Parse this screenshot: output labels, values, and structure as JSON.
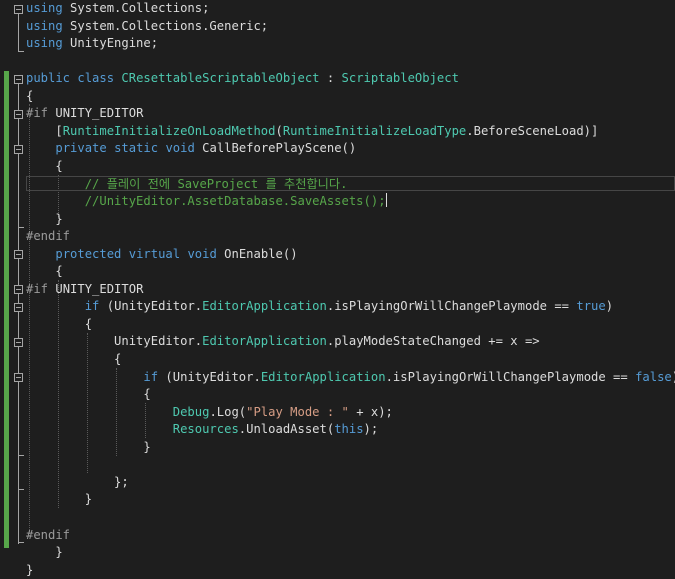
{
  "editor": {
    "lines": [
      [
        {
          "t": "using",
          "c": "kw"
        },
        {
          "t": " System.Collections;",
          "c": "tx"
        }
      ],
      [
        {
          "t": "using",
          "c": "kw"
        },
        {
          "t": " System.Collections.Generic;",
          "c": "tx"
        }
      ],
      [
        {
          "t": "using",
          "c": "kw"
        },
        {
          "t": " UnityEngine;",
          "c": "tx"
        }
      ],
      [],
      [
        {
          "t": "public",
          "c": "kw"
        },
        {
          "t": " ",
          "c": "tx"
        },
        {
          "t": "class",
          "c": "kw"
        },
        {
          "t": " ",
          "c": "tx"
        },
        {
          "t": "CResettableScriptableObject",
          "c": "ty"
        },
        {
          "t": " : ",
          "c": "tx"
        },
        {
          "t": "ScriptableObject",
          "c": "ty"
        }
      ],
      [
        {
          "t": "{",
          "c": "tx"
        }
      ],
      [
        {
          "t": "#if",
          "c": "pp"
        },
        {
          "t": " UNITY_EDITOR",
          "c": "tx"
        }
      ],
      [
        {
          "t": "    [",
          "c": "tx"
        },
        {
          "t": "RuntimeInitializeOnLoadMethod",
          "c": "ty"
        },
        {
          "t": "(",
          "c": "tx"
        },
        {
          "t": "RuntimeInitializeLoadType",
          "c": "ty"
        },
        {
          "t": ".BeforeSceneLoad)]",
          "c": "tx"
        }
      ],
      [
        {
          "t": "    ",
          "c": "tx"
        },
        {
          "t": "private",
          "c": "kw"
        },
        {
          "t": " ",
          "c": "tx"
        },
        {
          "t": "static",
          "c": "kw"
        },
        {
          "t": " ",
          "c": "tx"
        },
        {
          "t": "void",
          "c": "kw"
        },
        {
          "t": " CallBeforePlayScene()",
          "c": "tx"
        }
      ],
      [
        {
          "t": "    {",
          "c": "tx"
        }
      ],
      [
        {
          "t": "        // 플레이 전에 SaveProject 를 추천합니다.",
          "c": "cm"
        }
      ],
      [
        {
          "t": "        //UnityEditor.AssetDatabase.SaveAssets();",
          "c": "cm"
        }
      ],
      [
        {
          "t": "    }",
          "c": "tx"
        }
      ],
      [
        {
          "t": "#endif",
          "c": "pp"
        }
      ],
      [
        {
          "t": "    ",
          "c": "tx"
        },
        {
          "t": "protected",
          "c": "kw"
        },
        {
          "t": " ",
          "c": "tx"
        },
        {
          "t": "virtual",
          "c": "kw"
        },
        {
          "t": " ",
          "c": "tx"
        },
        {
          "t": "void",
          "c": "kw"
        },
        {
          "t": " OnEnable()",
          "c": "tx"
        }
      ],
      [
        {
          "t": "    {",
          "c": "tx"
        }
      ],
      [
        {
          "t": "#if",
          "c": "pp"
        },
        {
          "t": " UNITY_EDITOR",
          "c": "tx"
        }
      ],
      [
        {
          "t": "        ",
          "c": "tx"
        },
        {
          "t": "if",
          "c": "kw"
        },
        {
          "t": " (UnityEditor.",
          "c": "tx"
        },
        {
          "t": "EditorApplication",
          "c": "ty"
        },
        {
          "t": ".isPlayingOrWillChangePlaymode == ",
          "c": "tx"
        },
        {
          "t": "true",
          "c": "kw"
        },
        {
          "t": ")",
          "c": "tx"
        }
      ],
      [
        {
          "t": "        {",
          "c": "tx"
        }
      ],
      [
        {
          "t": "            UnityEditor.",
          "c": "tx"
        },
        {
          "t": "EditorApplication",
          "c": "ty"
        },
        {
          "t": ".playModeStateChanged += x =>",
          "c": "tx"
        }
      ],
      [
        {
          "t": "            {",
          "c": "tx"
        }
      ],
      [
        {
          "t": "                ",
          "c": "tx"
        },
        {
          "t": "if",
          "c": "kw"
        },
        {
          "t": " (UnityEditor.",
          "c": "tx"
        },
        {
          "t": "EditorApplication",
          "c": "ty"
        },
        {
          "t": ".isPlayingOrWillChangePlaymode == ",
          "c": "tx"
        },
        {
          "t": "false",
          "c": "kw"
        },
        {
          "t": ")",
          "c": "tx"
        }
      ],
      [
        {
          "t": "                {",
          "c": "tx"
        }
      ],
      [
        {
          "t": "                    ",
          "c": "tx"
        },
        {
          "t": "Debug",
          "c": "ty"
        },
        {
          "t": ".Log(",
          "c": "tx"
        },
        {
          "t": "\"Play Mode : \"",
          "c": "st"
        },
        {
          "t": " + x);",
          "c": "tx"
        }
      ],
      [
        {
          "t": "                    ",
          "c": "tx"
        },
        {
          "t": "Resources",
          "c": "ty"
        },
        {
          "t": ".UnloadAsset(",
          "c": "tx"
        },
        {
          "t": "this",
          "c": "kw"
        },
        {
          "t": ");",
          "c": "tx"
        }
      ],
      [
        {
          "t": "                }",
          "c": "tx"
        }
      ],
      [],
      [
        {
          "t": "            };",
          "c": "tx"
        }
      ],
      [
        {
          "t": "        }",
          "c": "tx"
        }
      ],
      [],
      [
        {
          "t": "#endif",
          "c": "pp"
        }
      ],
      [
        {
          "t": "    }",
          "c": "tx"
        }
      ],
      [
        {
          "t": "}",
          "c": "tx"
        }
      ]
    ],
    "current_line": 11,
    "caret_after_text": "        // 플레이 전에 SaveProject 를 추천합니다."
  }
}
